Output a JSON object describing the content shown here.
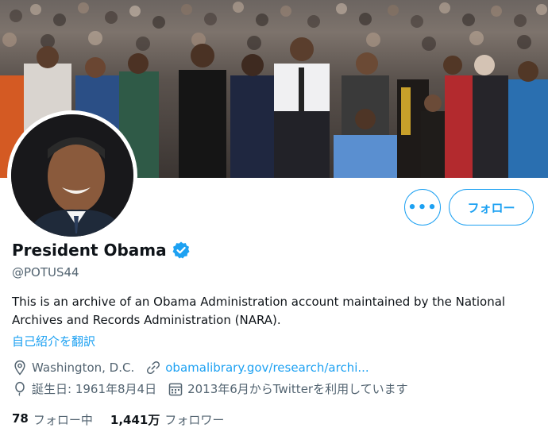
{
  "profile": {
    "name": "President Obama",
    "handle": "@POTUS44",
    "bio": "This is an archive of an Obama Administration account maintained by the National Archives and Records Administration (NARA).",
    "translate_label": "自己紹介を翻訳",
    "location": "Washington, D.C.",
    "website": "obamalibrary.gov/research/archi...",
    "birthday": "誕生日: 1961年8月4日",
    "joined": "2013年6月からTwitterを利用しています",
    "verified": true
  },
  "actions": {
    "more_label": "•••",
    "follow_label": "フォロー"
  },
  "stats": {
    "following_count": "78",
    "following_label": "フォロー中",
    "followers_count": "1,441万",
    "followers_label": "フォロワー"
  },
  "colors": {
    "accent": "#1da1f2",
    "text_primary": "#0f1419",
    "text_secondary": "#536471"
  },
  "icons": [
    "location-icon",
    "link-icon",
    "balloon-icon",
    "calendar-icon",
    "verified-badge-icon",
    "more-icon"
  ]
}
